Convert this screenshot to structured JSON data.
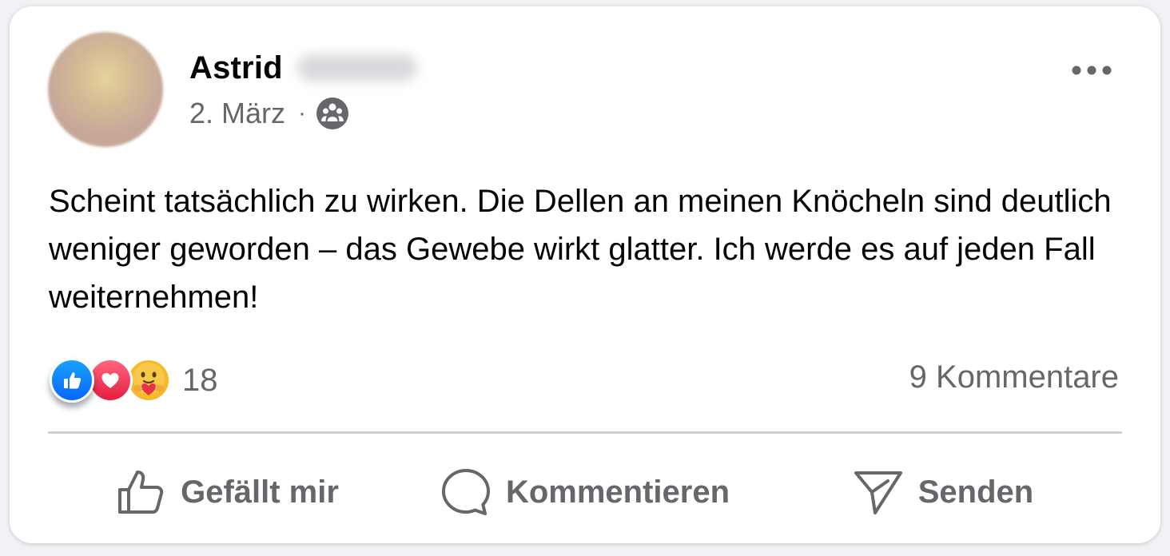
{
  "post": {
    "author_first_name": "Astrid",
    "date": "2. März",
    "separator": "·",
    "audience_icon": "group-icon",
    "text": "Scheint tatsächlich zu wirken. Die Dellen an meinen Knöcheln sind deutlich weniger geworden – das Gewebe wirkt glatter. Ich werde es auf jeden Fall weiternehmen!",
    "more_icon": "more-options-icon"
  },
  "reactions": {
    "types": [
      "like",
      "love",
      "care"
    ],
    "count": "18",
    "comments_label": "9 Kommentare"
  },
  "actions": {
    "like_label": "Gefällt mir",
    "comment_label": "Kommentieren",
    "send_label": "Senden"
  },
  "colors": {
    "primary_text": "#050505",
    "secondary_text": "#65676b",
    "like_blue": "#0866ff",
    "love_red": "#e41e3f",
    "care_yellow": "#f7b928"
  }
}
